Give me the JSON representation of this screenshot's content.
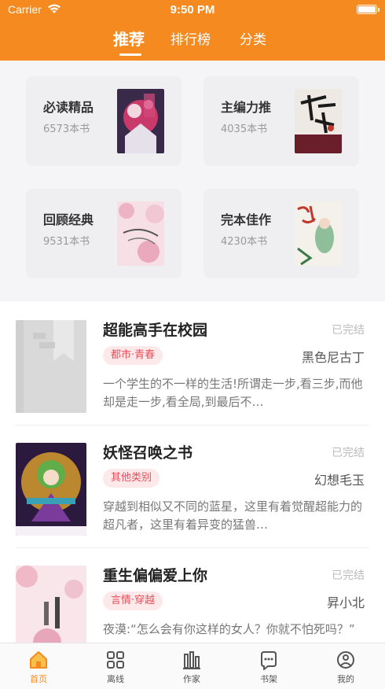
{
  "status_bar": {
    "carrier": "Carrier",
    "time": "9:50 PM"
  },
  "tabs": [
    {
      "label": "推荐",
      "active": true
    },
    {
      "label": "排行榜",
      "active": false
    },
    {
      "label": "分类",
      "active": false
    }
  ],
  "categories": [
    {
      "title": "必读精品",
      "count": "6573本书"
    },
    {
      "title": "主编力推",
      "count": "4035本书"
    },
    {
      "title": "回顾经典",
      "count": "9531本书"
    },
    {
      "title": "完本佳作",
      "count": "4230本书"
    }
  ],
  "books": [
    {
      "title": "超能高手在校园",
      "status": "已完结",
      "tag": "都市·青春",
      "author": "黑色尼古丁",
      "description": "一个学生的不一样的生活!所谓走一步,看三步,而他却是走一步,看全局,到最后不…"
    },
    {
      "title": "妖怪召唤之书",
      "status": "已完结",
      "tag": "其他类别",
      "author": "幻想毛玉",
      "description": "穿越到相似又不同的蓝星，这里有着觉醒超能力的超凡者，这里有着异变的猛兽…"
    },
    {
      "title": "重生偏偏爱上你",
      "status": "已完结",
      "tag": "言情·穿越",
      "author": "昇小北",
      "description": "夜漠:“怎么会有你这样的女人？你就不怕死吗？”"
    }
  ],
  "bottom_nav": [
    {
      "label": "首页",
      "icon": "home-icon",
      "active": true
    },
    {
      "label": "离线",
      "icon": "grid-icon",
      "active": false
    },
    {
      "label": "作家",
      "icon": "writer-icon",
      "active": false
    },
    {
      "label": "书架",
      "icon": "bookshelf-icon",
      "active": false
    },
    {
      "label": "我的",
      "icon": "profile-icon",
      "active": false
    }
  ],
  "colors": {
    "accent": "#f58b20",
    "tag_bg": "#fde8ea",
    "tag_text": "#e8505b"
  }
}
